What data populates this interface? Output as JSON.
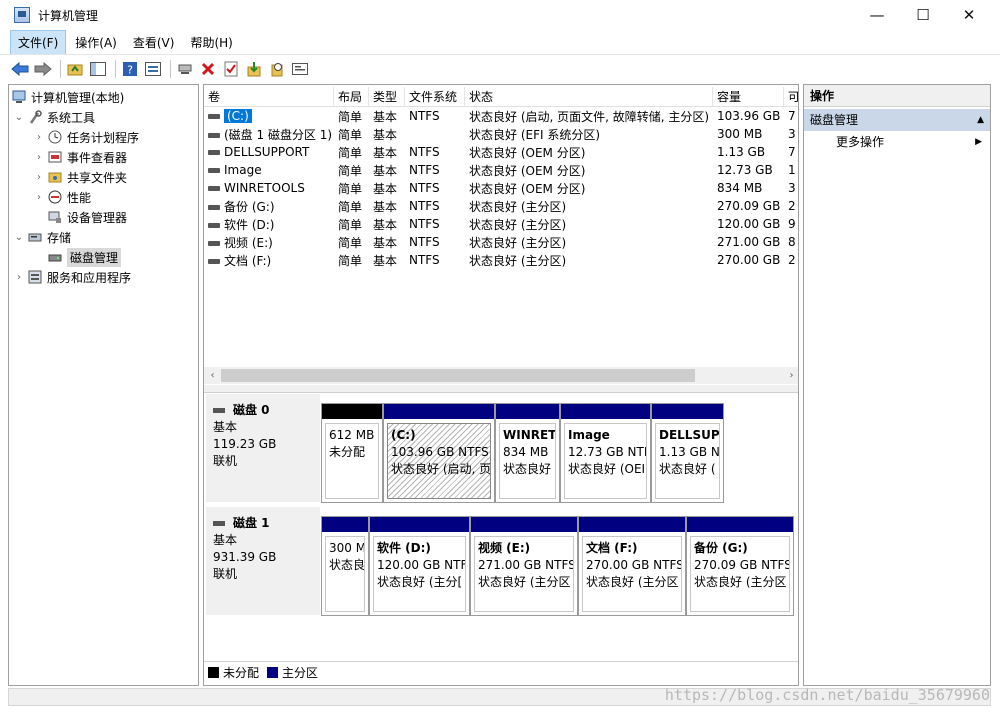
{
  "window": {
    "title": "计算机管理",
    "minimize": "—",
    "maximize": "☐",
    "close": "✕"
  },
  "menu": {
    "items": [
      {
        "label": "文件(F)",
        "active": true
      },
      {
        "label": "操作(A)"
      },
      {
        "label": "查看(V)"
      },
      {
        "label": "帮助(H)"
      }
    ]
  },
  "toolbar": {
    "icons": [
      "back-icon",
      "forward-icon",
      "sep",
      "up-folder-icon",
      "show-tree-icon",
      "sep",
      "help-icon",
      "properties-icon",
      "sep",
      "connect-icon",
      "delete-icon",
      "check-icon",
      "import-icon",
      "search-icon",
      "export-icon"
    ]
  },
  "tree": {
    "root": "计算机管理(本地)",
    "items": [
      {
        "label": "系统工具",
        "level": 1,
        "expanded": true,
        "icon": "tools-icon"
      },
      {
        "label": "任务计划程序",
        "level": 2,
        "icon": "clock-icon"
      },
      {
        "label": "事件查看器",
        "level": 2,
        "icon": "event-viewer-icon"
      },
      {
        "label": "共享文件夹",
        "level": 2,
        "icon": "shared-folder-icon"
      },
      {
        "label": "性能",
        "level": 2,
        "icon": "performance-icon"
      },
      {
        "label": "设备管理器",
        "level": 2,
        "icon": "device-manager-icon",
        "noarrow": true
      },
      {
        "label": "存储",
        "level": 1,
        "expanded": true,
        "icon": "storage-icon"
      },
      {
        "label": "磁盘管理",
        "level": 2,
        "selected": true,
        "icon": "disk-management-icon",
        "noarrow": true
      },
      {
        "label": "服务和应用程序",
        "level": 1,
        "icon": "services-icon"
      }
    ]
  },
  "volume_list": {
    "columns": [
      "卷",
      "布局",
      "类型",
      "文件系统",
      "状态",
      "容量",
      "可"
    ],
    "rows": [
      [
        "(C:)",
        "简单",
        "基本",
        "NTFS",
        "状态良好 (启动, 页面文件, 故障转储, 主分区)",
        "103.96 GB",
        "7"
      ],
      [
        "(磁盘 1 磁盘分区 1)",
        "简单",
        "基本",
        "",
        "状态良好 (EFI 系统分区)",
        "300 MB",
        "3"
      ],
      [
        "DELLSUPPORT",
        "简单",
        "基本",
        "NTFS",
        "状态良好 (OEM 分区)",
        "1.13 GB",
        "7"
      ],
      [
        "Image",
        "简单",
        "基本",
        "NTFS",
        "状态良好 (OEM 分区)",
        "12.73 GB",
        "1"
      ],
      [
        "WINRETOOLS",
        "简单",
        "基本",
        "NTFS",
        "状态良好 (OEM 分区)",
        "834 MB",
        "3"
      ],
      [
        "备份 (G:)",
        "简单",
        "基本",
        "NTFS",
        "状态良好 (主分区)",
        "270.09 GB",
        "2"
      ],
      [
        "软件 (D:)",
        "简单",
        "基本",
        "NTFS",
        "状态良好 (主分区)",
        "120.00 GB",
        "9"
      ],
      [
        "视频 (E:)",
        "简单",
        "基本",
        "NTFS",
        "状态良好 (主分区)",
        "271.00 GB",
        "8"
      ],
      [
        "文档 (F:)",
        "简单",
        "基本",
        "NTFS",
        "状态良好 (主分区)",
        "270.00 GB",
        "2"
      ]
    ]
  },
  "disks": [
    {
      "name": "磁盘 0",
      "type": "基本",
      "size": "119.23 GB",
      "status": "联机",
      "partitions": [
        {
          "name": "",
          "line1": "612 MB",
          "line2": "未分配",
          "kind": "unallocated"
        },
        {
          "name": "(C:)",
          "line1": "103.96 GB NTFS",
          "line2": "状态良好 (启动, 页",
          "kind": "primary",
          "hatched": true
        },
        {
          "name": "WINRET",
          "line1": "834 MB",
          "line2": "状态良好",
          "kind": "primary"
        },
        {
          "name": "Image",
          "line1": "12.73 GB NTF",
          "line2": "状态良好 (OEI",
          "kind": "primary"
        },
        {
          "name": "DELLSUP",
          "line1": "1.13 GB N",
          "line2": "状态良好 (",
          "kind": "primary"
        }
      ]
    },
    {
      "name": "磁盘 1",
      "type": "基本",
      "size": "931.39 GB",
      "status": "联机",
      "partitions": [
        {
          "name": "",
          "line1": "300 M",
          "line2": "状态良",
          "kind": "primary"
        },
        {
          "name": "软件 (D:)",
          "line1": "120.00 GB NTF",
          "line2": "状态良好 (主分[",
          "kind": "primary"
        },
        {
          "name": "视频 (E:)",
          "line1": "271.00 GB NTFS",
          "line2": "状态良好 (主分区",
          "kind": "primary"
        },
        {
          "name": "文档 (F:)",
          "line1": "270.00 GB NTFS",
          "line2": "状态良好 (主分区",
          "kind": "primary"
        },
        {
          "name": "备份 (G:)",
          "line1": "270.09 GB NTFS",
          "line2": "状态良好 (主分区",
          "kind": "primary"
        }
      ]
    }
  ],
  "legend": [
    {
      "label": "未分配",
      "color": "#000000"
    },
    {
      "label": "主分区",
      "color": "#000080"
    }
  ],
  "actions": {
    "header": "操作",
    "section": "磁盘管理",
    "items": [
      "更多操作"
    ]
  },
  "colors": {
    "primary": "#000080",
    "unallocated": "#000000",
    "selection": "#0078d7",
    "action_section": "#c9d7e8"
  },
  "watermark": "https://blog.csdn.net/baidu_35679960"
}
